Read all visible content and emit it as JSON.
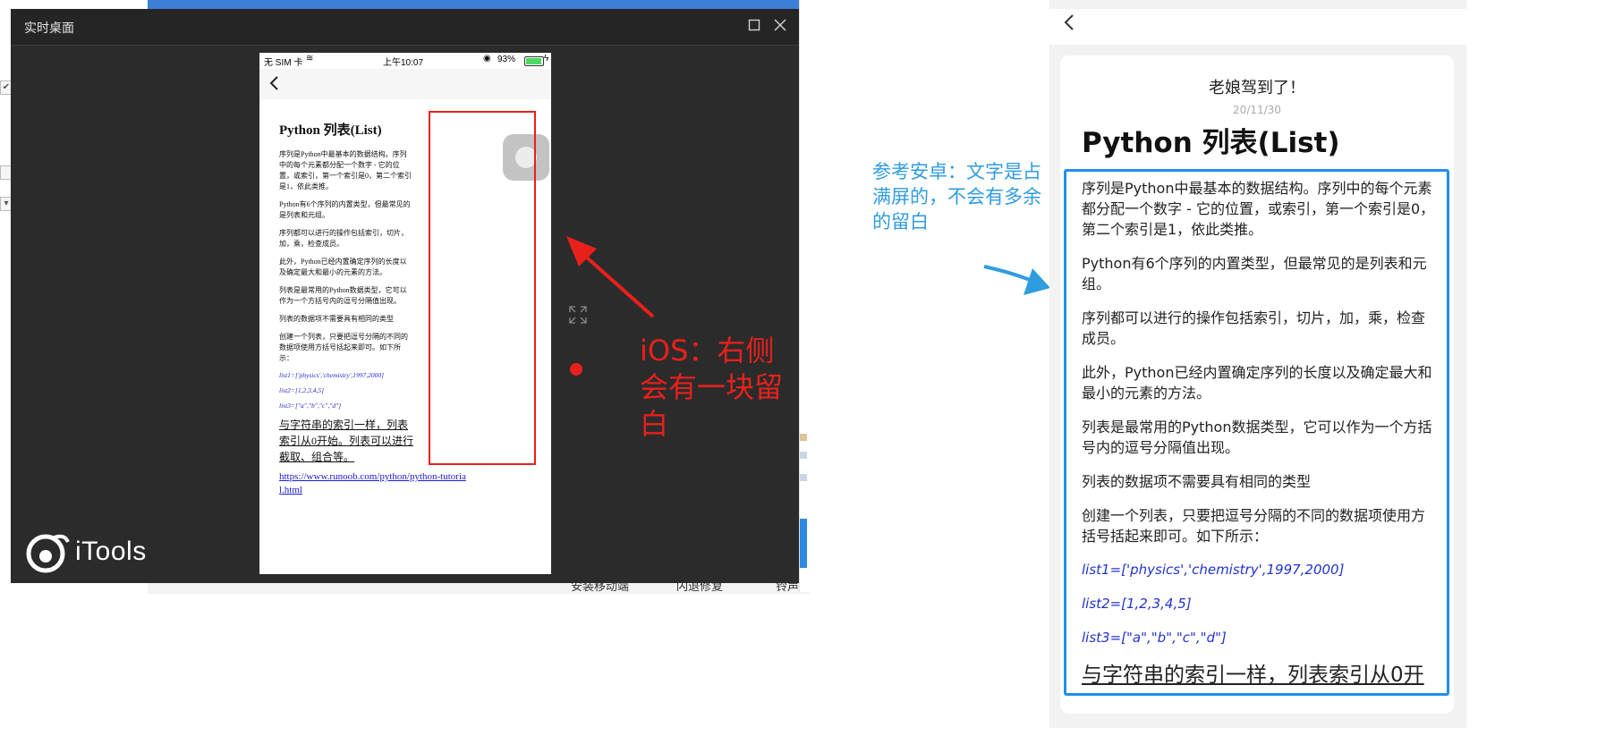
{
  "window": {
    "title": "实时桌面",
    "maximize_icon": "square-icon",
    "close_icon": "close-icon",
    "brand": "iTools"
  },
  "background_app": {
    "labels": [
      "安装移动端",
      "闪退修复",
      "铃声制"
    ]
  },
  "ios": {
    "status": {
      "carrier": "无 SIM 卡",
      "time": "上午10:07",
      "battery": "93%",
      "battery_level": 0.93
    },
    "article": {
      "title": "Python 列表(List)",
      "paragraphs": [
        "序列是Python中最基本的数据结构。序列中的每个元素都分配一个数字 - 它的位置，或索引，第一个索引是0，第二个索引是1，依此类推。",
        "Python有6个序列的内置类型，但最常见的是列表和元组。",
        "序列都可以进行的操作包括索引，切片，加，乘，检查成员。",
        "此外，Python已经内置确定序列的长度以及确定最大和最小的元素的方法。",
        "列表是最常用的Python数据类型，它可以作为一个方括号内的逗号分隔值出现。",
        "列表的数据项不需要具有相同的类型",
        "创建一个列表，只要把逗号分隔的不同的数据项使用方括号括起来即可。如下所示："
      ],
      "code": [
        "list1=['physics','chemistry',1997,2000]",
        "list2=[1,2,3,4,5]",
        "list3=[\"a\",\"b\",\"c\",\"d\"]"
      ],
      "big_text": "与字符串的索引一样，列表索引从0开始。列表可以进行截取、组合等。",
      "link": "https://www.runoob.com/python/python-tutorial.html"
    },
    "note": "iOS：右侧会有一块留白"
  },
  "android_note": "参考安卓：文字是占满屏的，不会有多余的留白",
  "android": {
    "author": "老娘驾到了！",
    "date": "20/11/30",
    "title": "Python 列表(List)",
    "paragraphs": [
      "序列是Python中最基本的数据结构。序列中的每个元素都分配一个数字 - 它的位置，或索引，第一个索引是0，第二个索引是1，依此类推。",
      "Python有6个序列的内置类型，但最常见的是列表和元组。",
      "序列都可以进行的操作包括索引，切片，加，乘，检查成员。",
      "此外，Python已经内置确定序列的长度以及确定最大和最小的元素的方法。",
      "列表是最常用的Python数据类型，它可以作为一个方括号内的逗号分隔值出现。",
      "列表的数据项不需要具有相同的类型",
      "创建一个列表，只要把逗号分隔的不同的数据项使用方括号括起来即可。如下所示："
    ],
    "code": [
      "list1=['physics','chemistry',1997,2000]",
      "list2=[1,2,3,4,5]",
      "list3=[\"a\",\"b\",\"c\",\"d\"]"
    ],
    "big_text": "与字符串的索引一样，列表索引从0开"
  },
  "colors": {
    "annotation_red": "#e8201c",
    "annotation_blue": "#2f9ce0",
    "android_box_blue": "#1f8fe8",
    "window_dark": "#2b2b2b"
  }
}
